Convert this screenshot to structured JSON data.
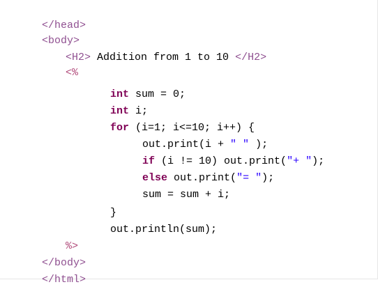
{
  "code": {
    "lines": [
      {
        "segments": [
          "</head>"
        ]
      },
      {
        "segments": [
          "<body>"
        ]
      },
      {
        "segments": [
          "<H2>",
          " Addition from 1 to 10 ",
          "</H2>"
        ]
      },
      {
        "segments": [
          "<%"
        ]
      },
      {
        "segments": [
          "int",
          " sum = 0;"
        ]
      },
      {
        "segments": [
          "int",
          " i;"
        ]
      },
      {
        "segments": [
          "for",
          " (i=1; i<=10; i++) {"
        ]
      },
      {
        "segments": [
          "out.print(i + ",
          "\" \"",
          " );"
        ]
      },
      {
        "segments": [
          "if",
          " (i != 10) out.print(",
          "\"+ \"",
          ");"
        ]
      },
      {
        "segments": [
          "else",
          " out.print(",
          "\"= \"",
          ");"
        ]
      },
      {
        "segments": [
          "sum = sum + i;"
        ]
      },
      {
        "segments": [
          "}"
        ]
      },
      {
        "segments": [
          "out.println(sum);"
        ]
      },
      {
        "segments": [
          "%>"
        ]
      },
      {
        "segments": [
          "</body>"
        ]
      },
      {
        "segments": [
          "</html>"
        ]
      }
    ]
  },
  "colors": {
    "html_tag": "#8f4f90",
    "jsp_delimiter": "#b14a7a",
    "keyword": "#7f0055",
    "string": "#2a00ff",
    "text": "#000000"
  }
}
